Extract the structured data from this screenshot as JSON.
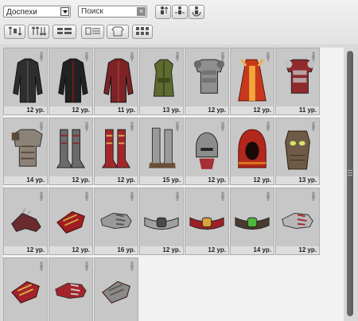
{
  "filter": {
    "category_value": "Доспехи"
  },
  "search": {
    "text": "Поиск",
    "clear_glyph": "×"
  },
  "toolbar": {
    "row1": [
      {
        "name": "sort-level-button",
        "icon": "figure-up-icon"
      },
      {
        "name": "sort-class-button",
        "icon": "figure-swap-icon"
      },
      {
        "name": "sort-reset-button",
        "icon": "figure-refresh-icon"
      }
    ],
    "row2": [
      {
        "name": "sort-price-button",
        "icon": "up-down-arrows-icon"
      },
      {
        "name": "sort-name-button",
        "icon": "up-down-double-icon"
      },
      {
        "name": "view-compact-button",
        "icon": "grid-compact-icon"
      },
      {
        "name": "view-list-button",
        "icon": "list-icon"
      },
      {
        "name": "view-armor-button",
        "icon": "armor-icon"
      },
      {
        "name": "view-tiles-button",
        "icon": "tiles-icon"
      }
    ]
  },
  "items": [
    {
      "kind": "jacket",
      "color": "#2e2e2e",
      "accent": "#555555",
      "level": "12 ур."
    },
    {
      "kind": "jacket",
      "color": "#222222",
      "accent": "#8a1a1a",
      "level": "12 ур."
    },
    {
      "kind": "jacket",
      "color": "#7d2326",
      "accent": "#a33a3a",
      "level": "11 ур."
    },
    {
      "kind": "vest",
      "color": "#5e6b2e",
      "accent": "#3c4a1d",
      "level": "13 ур."
    },
    {
      "kind": "cuirass",
      "color": "#8f8f8f",
      "accent": "#6b6b6b",
      "level": "12 ур."
    },
    {
      "kind": "robe",
      "color": "#c9381c",
      "accent": "#f2a73a",
      "level": "12 ур."
    },
    {
      "kind": "cuirass",
      "color": "#8e2a2e",
      "accent": "#c2c2c2",
      "level": "11 ур."
    },
    {
      "kind": "plate",
      "color": "#8c8378",
      "accent": "#5a4a3a",
      "level": "14 ур."
    },
    {
      "kind": "boots",
      "color": "#6b6b6b",
      "accent": "#8a2a2a",
      "level": "12 ур."
    },
    {
      "kind": "boots",
      "color": "#a4262c",
      "accent": "#d6a84a",
      "level": "12 ур."
    },
    {
      "kind": "greaves",
      "color": "#9a9a9a",
      "accent": "#6b4e34",
      "level": "15 ур."
    },
    {
      "kind": "helmet",
      "color": "#8c8c8c",
      "accent": "#a72f36",
      "level": "12 ур."
    },
    {
      "kind": "hood",
      "color": "#b2271c",
      "accent": "#e07a1c",
      "level": "12 ур."
    },
    {
      "kind": "mask",
      "color": "#6e5a46",
      "accent": "#d8e36a",
      "level": "13 ур."
    },
    {
      "kind": "glove",
      "color": "#6b2a2e",
      "accent": "#a8a8a8",
      "level": "12 ур."
    },
    {
      "kind": "bracer",
      "color": "#a01e22",
      "accent": "#d1a042",
      "level": "12 ур."
    },
    {
      "kind": "gauntlet",
      "color": "#9a9a9a",
      "accent": "#555555",
      "level": "16 ур."
    },
    {
      "kind": "belt",
      "color": "#a0a0a0",
      "accent": "#4a4a4a",
      "level": "12 ур."
    },
    {
      "kind": "belt",
      "color": "#a01f26",
      "accent": "#d9a43c",
      "level": "12 ур."
    },
    {
      "kind": "belt",
      "color": "#4a3a2e",
      "accent": "#4db83a",
      "level": "14 ур."
    },
    {
      "kind": "gauntlet",
      "color": "#b8b8b8",
      "accent": "#a62b30",
      "level": "12 ур."
    },
    {
      "kind": "bracer",
      "color": "#a3232a",
      "accent": "#d8b04a",
      "level": ""
    },
    {
      "kind": "gauntlet",
      "color": "#a3232a",
      "accent": "#c9c9c9",
      "level": ""
    },
    {
      "kind": "bracer",
      "color": "#8a8a8a",
      "accent": "#5f5a4e",
      "level": ""
    }
  ]
}
